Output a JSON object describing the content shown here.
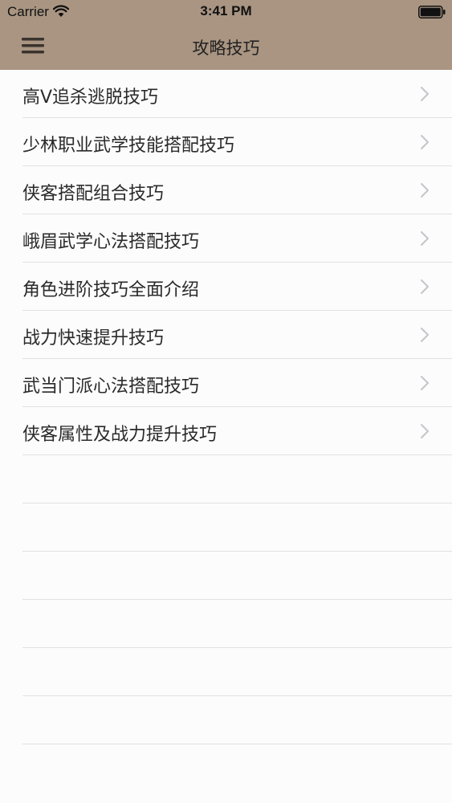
{
  "status_bar": {
    "carrier": "Carrier",
    "time": "3:41 PM"
  },
  "nav_bar": {
    "title": "攻略技巧",
    "menu_icon": "hamburger-menu-icon",
    "background_color": "#a99582"
  },
  "list": {
    "items": [
      {
        "label": "高V追杀逃脱技巧"
      },
      {
        "label": "少林职业武学技能搭配技巧"
      },
      {
        "label": "侠客搭配组合技巧"
      },
      {
        "label": "峨眉武学心法搭配技巧"
      },
      {
        "label": "角色进阶技巧全面介绍"
      },
      {
        "label": "战力快速提升技巧"
      },
      {
        "label": "武当门派心法搭配技巧"
      },
      {
        "label": "侠客属性及战力提升技巧"
      }
    ],
    "row_icon": "chevron-right-icon"
  }
}
